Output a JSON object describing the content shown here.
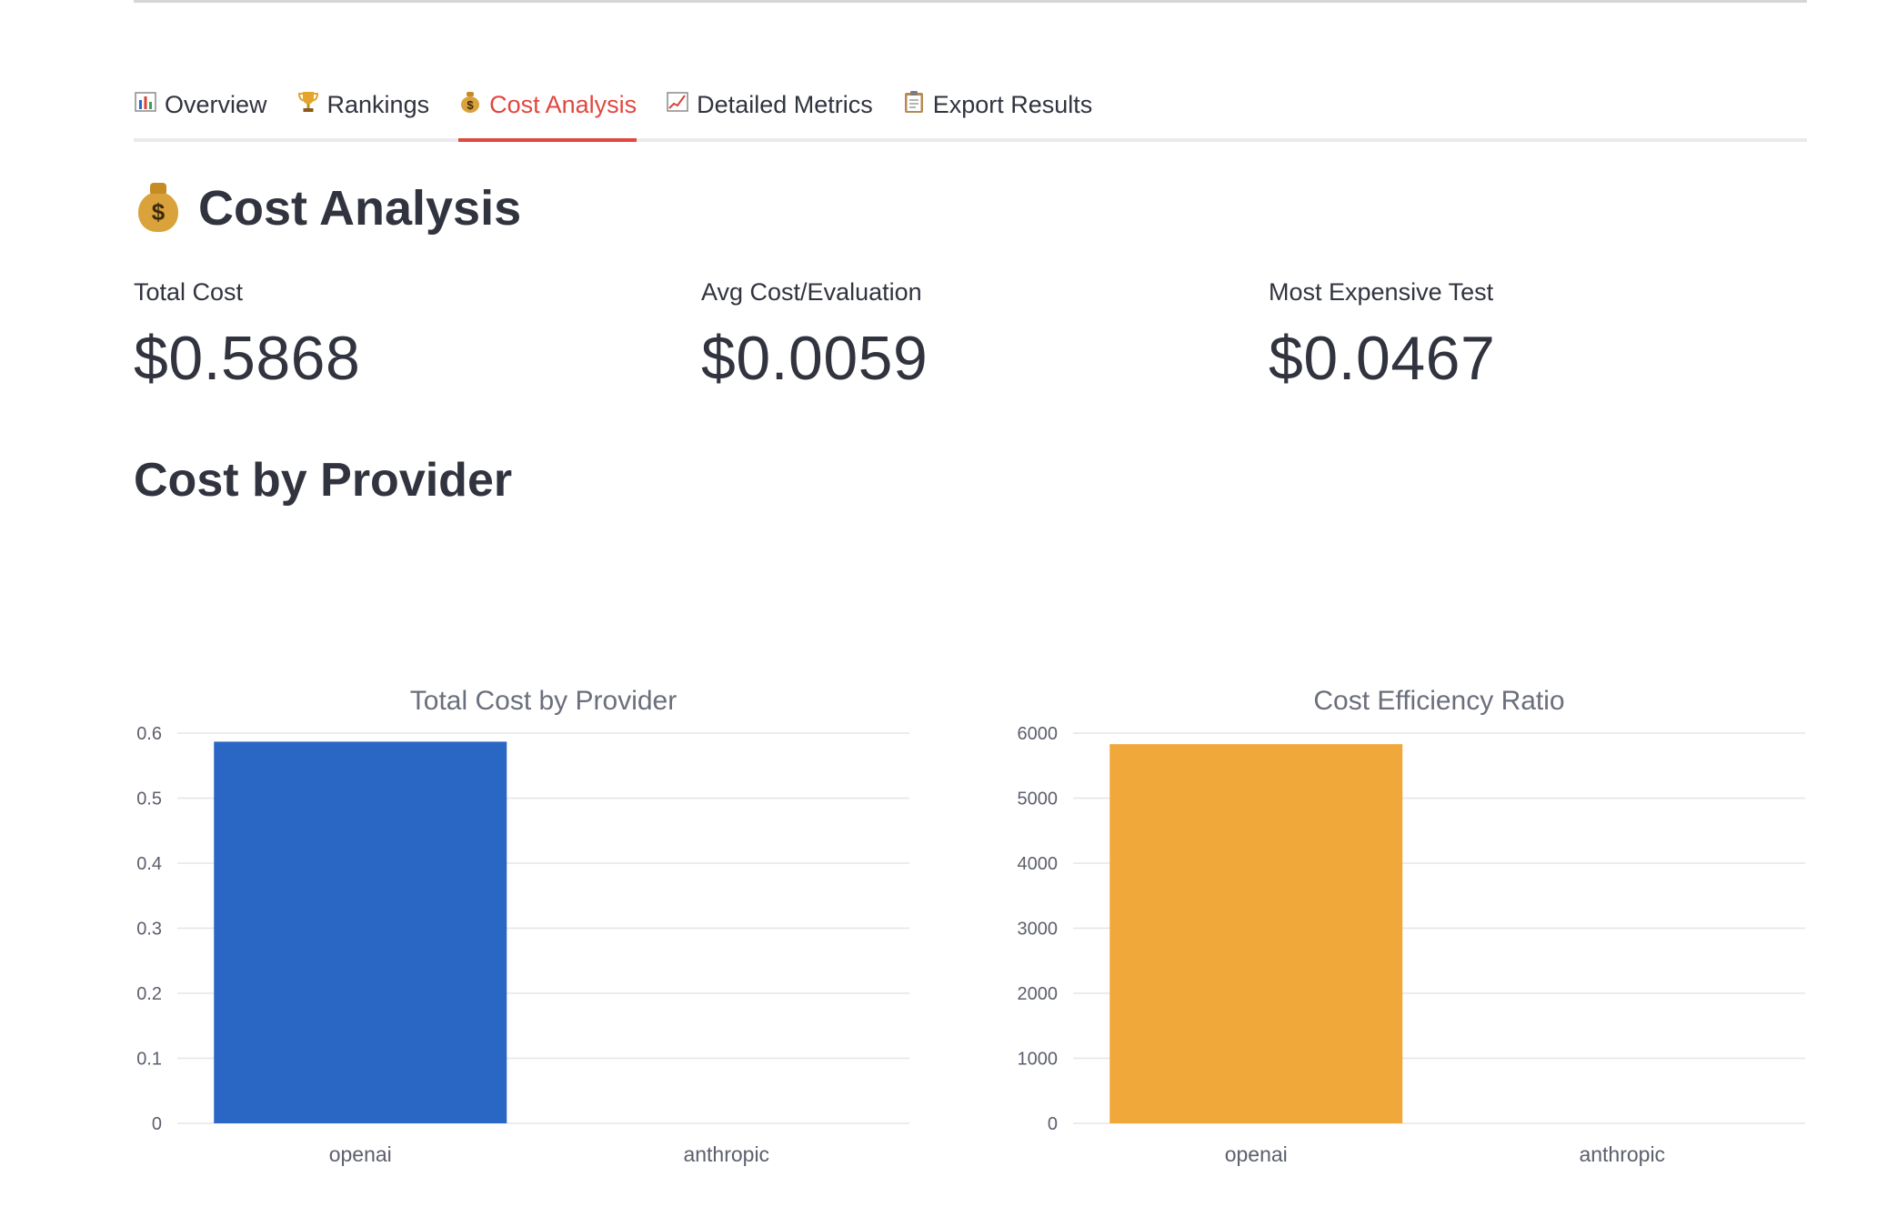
{
  "tabs": [
    {
      "label": "Overview",
      "icon": "bar-chart-icon",
      "active": false
    },
    {
      "label": "Rankings",
      "icon": "trophy-icon",
      "active": false
    },
    {
      "label": "Cost Analysis",
      "icon": "money-bag-icon",
      "active": true
    },
    {
      "label": "Detailed Metrics",
      "icon": "chart-increasing-icon",
      "active": false
    },
    {
      "label": "Export Results",
      "icon": "clipboard-icon",
      "active": false
    }
  ],
  "heading": {
    "title": "Cost Analysis",
    "icon": "money-bag-icon"
  },
  "metrics": [
    {
      "label": "Total Cost",
      "value": "$0.5868"
    },
    {
      "label": "Avg Cost/Evaluation",
      "value": "$0.0059"
    },
    {
      "label": "Most Expensive Test",
      "value": "$0.0467"
    }
  ],
  "section": {
    "title": "Cost by Provider"
  },
  "colors": {
    "accent": "#e0473f",
    "bar_blue": "#2a66c4",
    "bar_orange": "#f0a83a",
    "grid": "#e6e6ea"
  },
  "chart_data": [
    {
      "type": "bar",
      "title": "Total Cost by Provider",
      "categories": [
        "openai",
        "anthropic"
      ],
      "values": [
        0.5868,
        0
      ],
      "ylim": [
        0,
        0.6
      ],
      "yticks": [
        0,
        0.1,
        0.2,
        0.3,
        0.4,
        0.5,
        0.6
      ],
      "color": "#2a66c4",
      "grid": true
    },
    {
      "type": "bar",
      "title": "Cost Efficiency Ratio",
      "categories": [
        "openai",
        "anthropic"
      ],
      "values": [
        5830,
        0
      ],
      "ylim": [
        0,
        6000
      ],
      "yticks": [
        0,
        1000,
        2000,
        3000,
        4000,
        5000,
        6000
      ],
      "color": "#f0a83a",
      "grid": true
    }
  ]
}
